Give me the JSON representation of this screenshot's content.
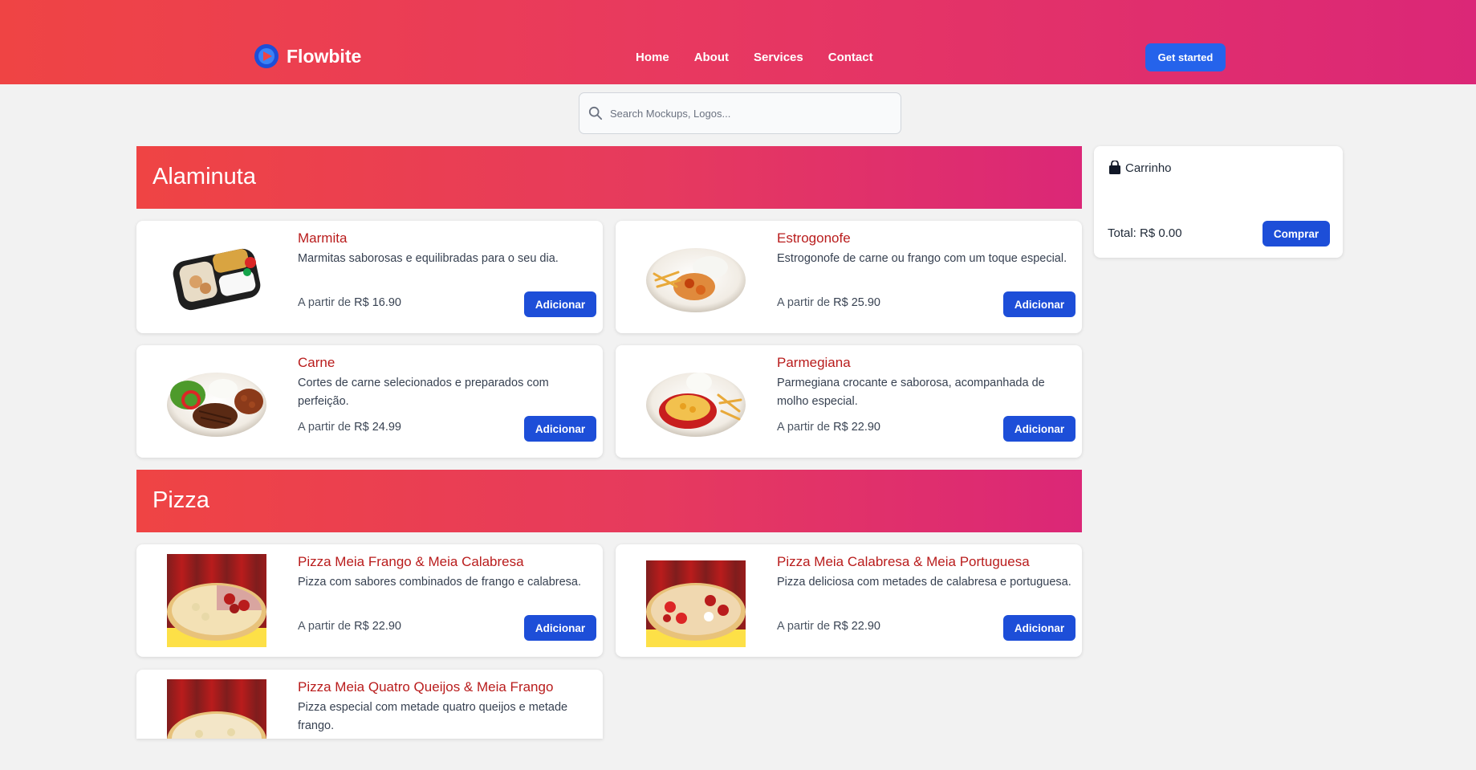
{
  "nav": {
    "brand": "Flowbite",
    "links": [
      "Home",
      "About",
      "Services",
      "Contact"
    ],
    "cta": "Get started"
  },
  "search": {
    "placeholder": "Search Mockups, Logos..."
  },
  "categories": [
    {
      "title": "Alaminuta",
      "items": [
        {
          "name": "Marmita",
          "desc": "Marmitas saborosas e equilibradas para o seu dia.",
          "price_prefix": "A partir de",
          "price": "R$ 16.90",
          "button": "Adicionar",
          "image": "marmita-photo"
        },
        {
          "name": "Estrogonofe",
          "desc": "Estrogonofe de carne ou frango com um toque especial.",
          "price_prefix": "A partir de",
          "price": "R$ 25.90",
          "button": "Adicionar",
          "image": "estrogonofe-photo"
        },
        {
          "name": "Carne",
          "desc": "Cortes de carne selecionados e preparados com perfeição.",
          "price_prefix": "A partir de",
          "price": "R$ 24.99",
          "button": "Adicionar",
          "image": "carne-photo"
        },
        {
          "name": "Parmegiana",
          "desc": "Parmegiana crocante e saborosa, acompanhada de molho especial.",
          "price_prefix": "A partir de",
          "price": "R$ 22.90",
          "button": "Adicionar",
          "image": "parmegiana-photo"
        }
      ]
    },
    {
      "title": "Pizza",
      "items": [
        {
          "name": "Pizza Meia Frango & Meia Calabresa",
          "desc": "Pizza com sabores combinados de frango e calabresa.",
          "price_prefix": "A partir de",
          "price": "R$ 22.90",
          "button": "Adicionar",
          "image": "pizza-photo"
        },
        {
          "name": "Pizza Meia Calabresa & Meia Portuguesa",
          "desc": "Pizza deliciosa com metades de calabresa e portuguesa.",
          "price_prefix": "A partir de",
          "price": "R$ 22.90",
          "button": "Adicionar",
          "image": "pizza-photo"
        },
        {
          "name": "Pizza Meia Quatro Queijos & Meia Frango",
          "desc": "Pizza especial com metade quatro queijos e metade frango.",
          "image": "pizza-photo"
        }
      ]
    }
  ],
  "cart": {
    "title": "Carrinho",
    "total_label": "Total:",
    "total_value": "R$ 0.00",
    "button": "Comprar"
  },
  "colors": {
    "accent_red": "#b91c1c",
    "button_blue": "#1d4ed8",
    "gradient_start": "#ef4444",
    "gradient_end": "#db2777"
  }
}
